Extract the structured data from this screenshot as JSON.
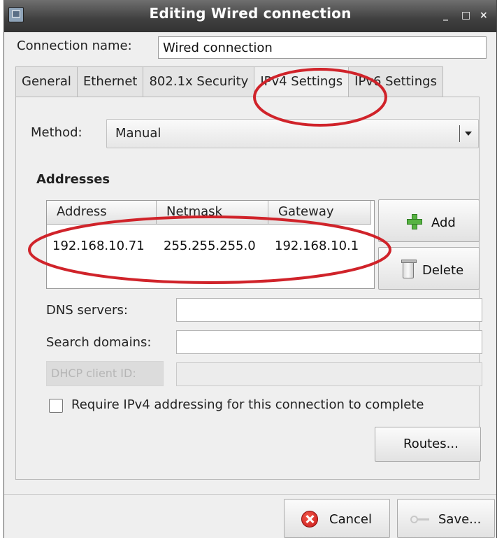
{
  "window": {
    "title": "Editing Wired connection",
    "controls": [
      "_",
      "□",
      "×"
    ]
  },
  "connection": {
    "name_label": "Connection name:",
    "name_value": "Wired connection"
  },
  "tabs": [
    {
      "label": "General",
      "active": false
    },
    {
      "label": "Ethernet",
      "active": false
    },
    {
      "label": "802.1x Security",
      "active": false
    },
    {
      "label": "IPv4 Settings",
      "active": true
    },
    {
      "label": "IPv6 Settings",
      "active": false
    }
  ],
  "ipv4": {
    "method_label": "Method:",
    "method_value": "Manual",
    "addresses_title": "Addresses",
    "columns": [
      "Address",
      "Netmask",
      "Gateway"
    ],
    "rows": [
      {
        "address": "192.168.10.71",
        "netmask": "255.255.255.0",
        "gateway": "192.168.10.1"
      }
    ],
    "add_label": "Add",
    "delete_label": "Delete",
    "dns_label": "DNS servers:",
    "dns_value": "",
    "search_label": "Search domains:",
    "search_value": "",
    "dhcp_label": "DHCP client ID:",
    "dhcp_value": "",
    "require_label": "Require IPv4 addressing for this connection to complete",
    "require_checked": false,
    "routes_label": "Routes..."
  },
  "footer": {
    "cancel_label": "Cancel",
    "save_label": "Save..."
  },
  "colors": {
    "annotation": "#d0232a",
    "add_icon": "#57b342",
    "cancel_icon": "#d9302a"
  },
  "icons": {
    "window": "network-window-icon",
    "add": "plus-icon",
    "delete": "trash-icon",
    "cancel": "cancel-icon",
    "save": "key-icon"
  }
}
